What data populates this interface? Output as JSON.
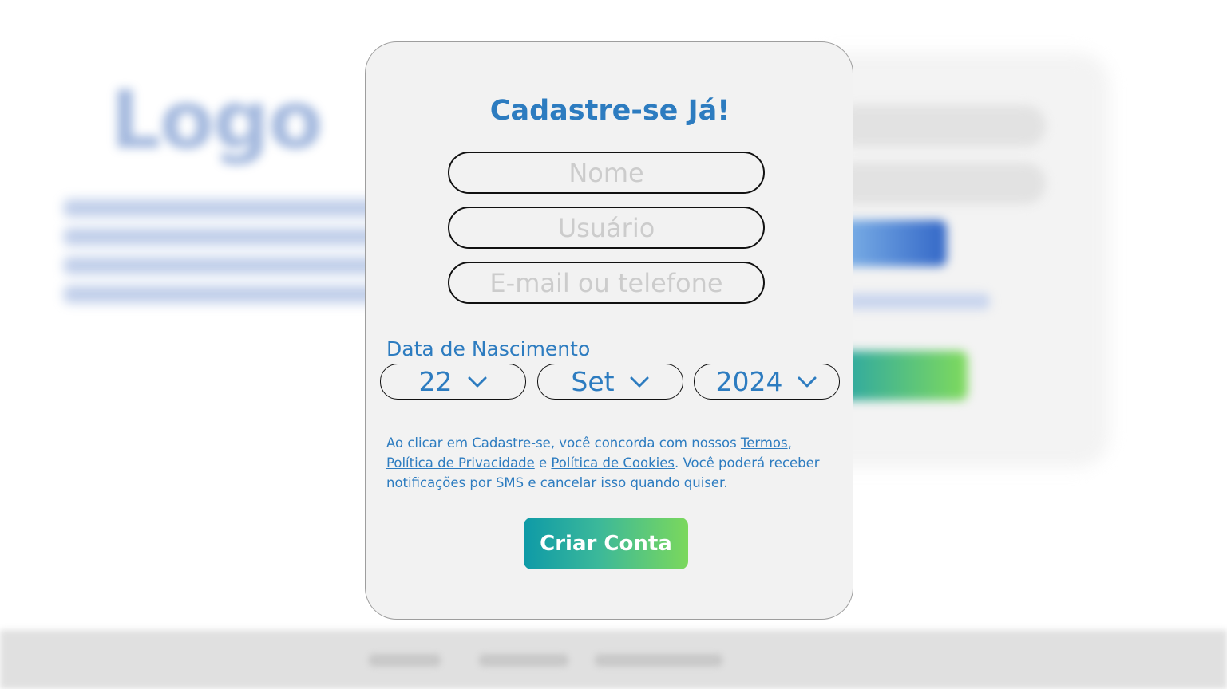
{
  "background": {
    "logo_text": "Logo"
  },
  "signup": {
    "title": "Cadastre-se Já!",
    "fields": {
      "name_placeholder": "Nome",
      "user_placeholder": "Usuário",
      "contact_placeholder": "E-mail ou telefone"
    },
    "dob": {
      "label": "Data de Nascimento",
      "day": "22",
      "month": "Set",
      "year": "2024"
    },
    "terms": {
      "prefix": "Ao clicar em Cadastre-se, você concorda com nossos ",
      "terms_link": "Termos",
      "sep1": ", ",
      "privacy_link": "Política de Privacidade",
      "sep2": " e ",
      "cookies_link": "Política de Cookies",
      "suffix": ". Você poderá receber notificações por SMS e cancelar isso quando quiser."
    },
    "submit_label": "Criar Conta"
  },
  "colors": {
    "accent": "#2d7cc0",
    "gradient_start": "#0e9aa7",
    "gradient_end": "#7bd85c",
    "modal_bg": "#f2f2f2"
  }
}
